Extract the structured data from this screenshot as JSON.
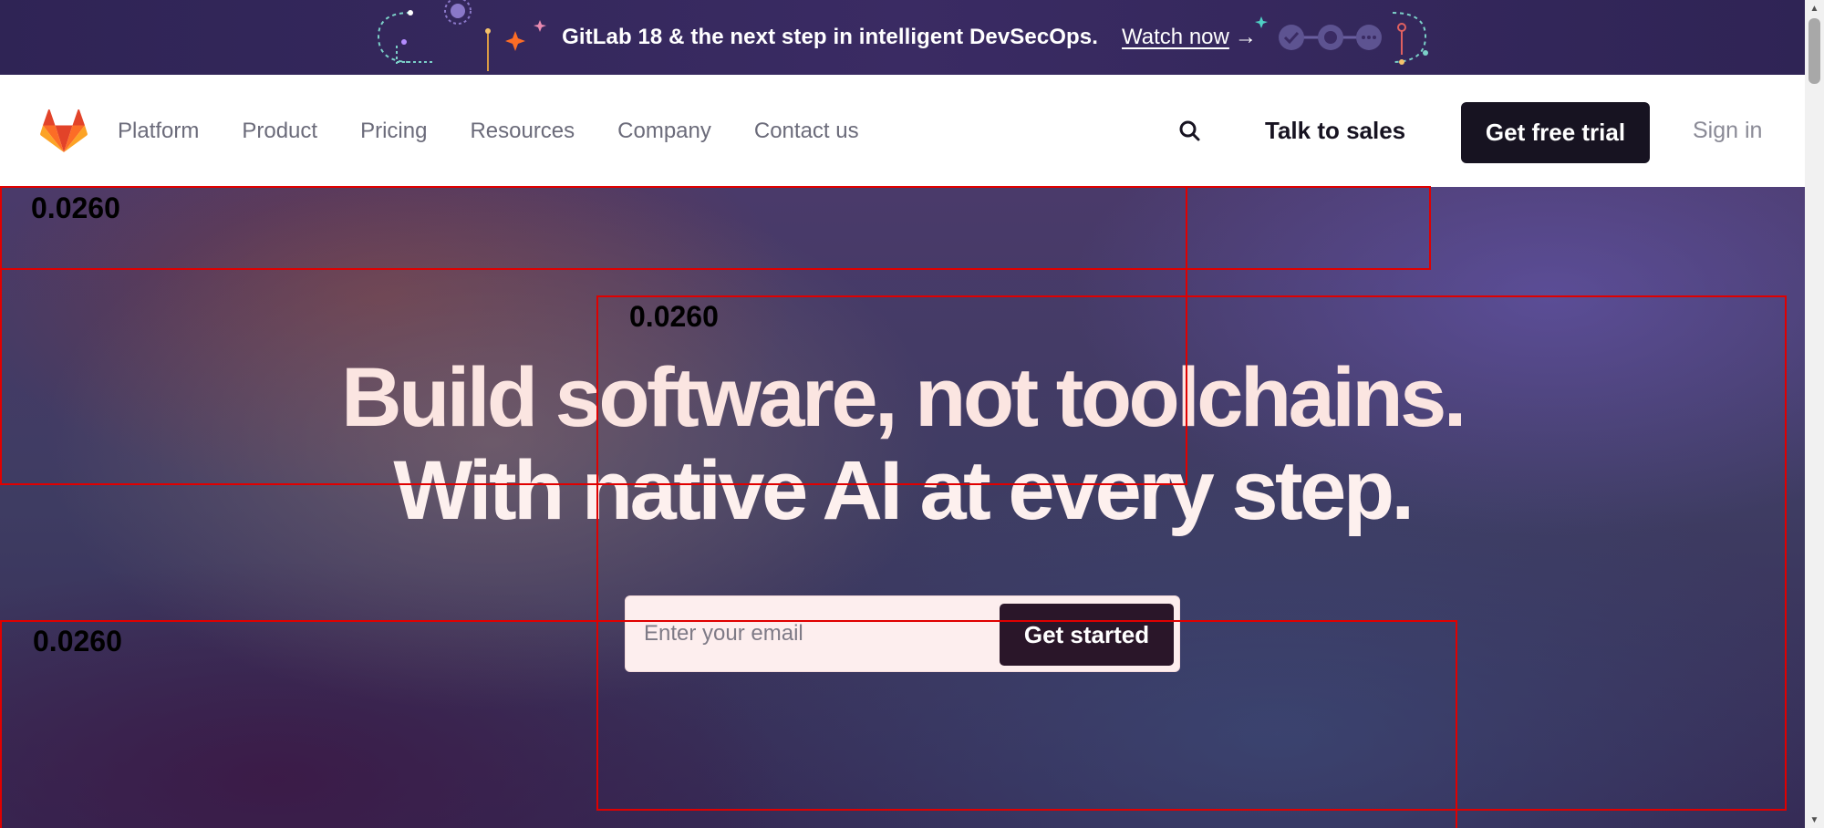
{
  "banner": {
    "text": "GitLab 18 & the next step in intelligent DevSecOps.",
    "link": "Watch now",
    "arrow": "→"
  },
  "nav": {
    "logo_icon": "gitlab-tanuki-icon",
    "links": [
      "Platform",
      "Product",
      "Pricing",
      "Resources",
      "Company",
      "Contact us"
    ],
    "search_icon": "search-icon",
    "talk_to_sales": "Talk to sales",
    "free_trial": "Get free trial",
    "sign_in": "Sign in"
  },
  "hero": {
    "title_line1": "Build software, not toolchains.",
    "title_line2": "With native AI at every step.",
    "email_placeholder": "Enter your email",
    "cta": "Get started"
  },
  "annotations": [
    {
      "label": "0.0260"
    },
    {
      "label": "0.0260"
    },
    {
      "label": "0.0260"
    }
  ],
  "colors": {
    "banner_bg": "#2f2455",
    "nav_bg": "#ffffff",
    "primary_button": "#171321",
    "cta_button": "#2a1629",
    "hero_text": "#fbe5e1",
    "annotation": "#e00000",
    "logo_orange": "#e24329",
    "accent_orange": "#fc6d26"
  }
}
